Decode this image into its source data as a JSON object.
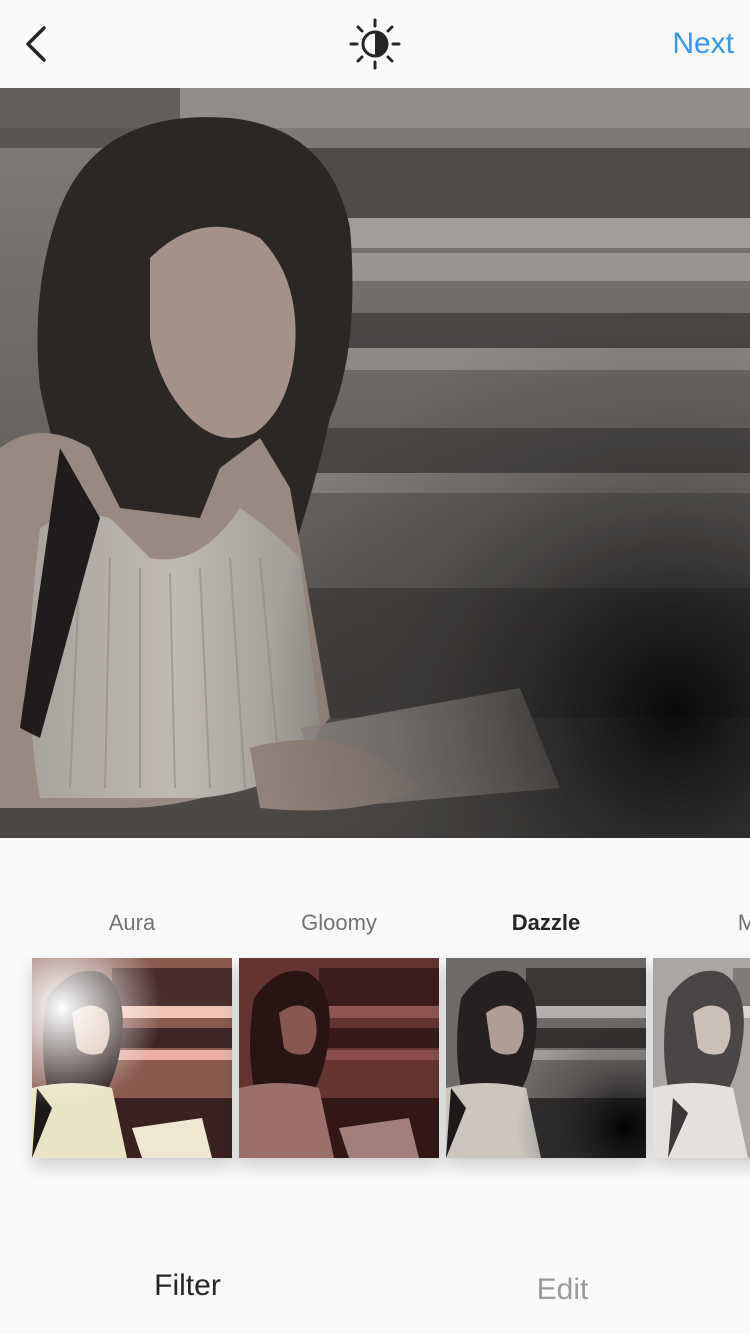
{
  "header": {
    "back_icon": "chevron-left-icon",
    "lux_icon": "lux-sun-icon",
    "next_label": "Next",
    "accent_color": "#3897f0"
  },
  "photo": {
    "description_icon": "photo-preview",
    "active_filter": "Dazzle"
  },
  "filters": [
    {
      "label": "Aura",
      "selected": false
    },
    {
      "label": "Gloomy",
      "selected": false
    },
    {
      "label": "Dazzle",
      "selected": true
    },
    {
      "label": "Mo",
      "selected": false
    }
  ],
  "tabs": {
    "filter_label": "Filter",
    "edit_label": "Edit",
    "active": "Filter"
  }
}
